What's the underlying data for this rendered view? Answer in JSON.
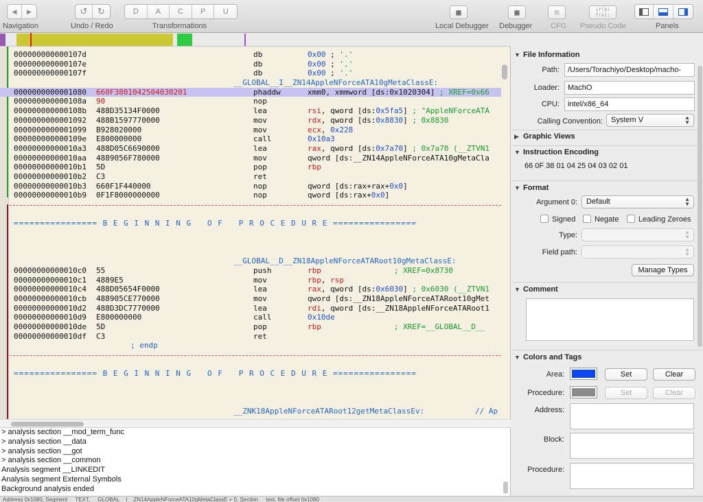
{
  "toolbar": {
    "navigation_label": "Navigation",
    "undo_redo_label": "Undo / Redo",
    "transformations_label": "Transformations",
    "transform_buttons": [
      "D",
      "A",
      "C",
      "P",
      "U"
    ],
    "nav_back": "◀",
    "nav_forward": "▶",
    "undo": "↺",
    "redo": "↻",
    "local_debugger_label": "Local Debugger",
    "debugger_label": "Debugger",
    "cfg_label": "CFG",
    "pseudo_code_label": "Pseudo Code",
    "pseudo_code_icon": "if(b)\nf(x);",
    "panels_label": "Panels"
  },
  "disasm": {
    "lines": [
      {
        "addr": "000000000000107d",
        "bytes": "",
        "mn": "db",
        "op_parts": [
          {
            "t": "0x00",
            "c": "blue"
          },
          {
            "t": " ; ",
            "c": ""
          },
          {
            "t": "'.'",
            "c": "green"
          }
        ]
      },
      {
        "addr": "000000000000107e",
        "bytes": "",
        "mn": "db",
        "op_parts": [
          {
            "t": "0x00",
            "c": "blue"
          },
          {
            "t": " ; ",
            "c": ""
          },
          {
            "t": "'.'",
            "c": "green"
          }
        ]
      },
      {
        "addr": "000000000000107f",
        "bytes": "",
        "mn": "db",
        "op_parts": [
          {
            "t": "0x00",
            "c": "blue"
          },
          {
            "t": " ; ",
            "c": ""
          },
          {
            "t": "'.'",
            "c": "green"
          }
        ]
      },
      {
        "label": "__GLOBAL__I__ZN14AppleNForceATA10gMetaClassE:"
      },
      {
        "addr": "0000000000001080",
        "bytes": "660F3801042504030201",
        "bytes_red": true,
        "mn": "phaddw",
        "hl": true,
        "op_parts": [
          {
            "t": "xmm0, xmmword [ds:0x1020304]",
            "c": ""
          },
          {
            "t": " ; XREF=0x66",
            "c": "green"
          }
        ]
      },
      {
        "addr": "000000000000108a",
        "bytes": "90",
        "bytes_red": true,
        "mn": "nop",
        "op_parts": []
      },
      {
        "addr": "000000000000108b",
        "bytes": "488D35134F0000",
        "mn": "lea",
        "op_parts": [
          {
            "t": "rsi",
            "c": "red"
          },
          {
            "t": ", qword [ds:",
            "c": ""
          },
          {
            "t": "0x5fa5",
            "c": "blue"
          },
          {
            "t": "]",
            "c": ""
          },
          {
            "t": " ; \"AppleNForceATA",
            "c": "green"
          }
        ]
      },
      {
        "addr": "0000000000001092",
        "bytes": "488B1597770000",
        "mn": "mov",
        "op_parts": [
          {
            "t": "rdx",
            "c": "red"
          },
          {
            "t": ", qword [ds:",
            "c": ""
          },
          {
            "t": "0x8830",
            "c": "blue"
          },
          {
            "t": "]",
            "c": ""
          },
          {
            "t": " ; 0x8830",
            "c": "green"
          }
        ]
      },
      {
        "addr": "0000000000001099",
        "bytes": "B928020000",
        "mn": "mov",
        "op_parts": [
          {
            "t": "ecx",
            "c": "red"
          },
          {
            "t": ", ",
            "c": ""
          },
          {
            "t": "0x228",
            "c": "blue"
          }
        ]
      },
      {
        "addr": "000000000000109e",
        "bytes": "E800000000",
        "mn": "call",
        "op_parts": [
          {
            "t": "0x10a3",
            "c": "blue"
          }
        ]
      },
      {
        "addr": "00000000000010a3",
        "bytes": "488D05C6690000",
        "mn": "lea",
        "op_parts": [
          {
            "t": "rax",
            "c": "red"
          },
          {
            "t": ", qword [ds:",
            "c": ""
          },
          {
            "t": "0x7a70",
            "c": "blue"
          },
          {
            "t": "]",
            "c": ""
          },
          {
            "t": " ; 0x7a70 (__ZTVN1",
            "c": "green"
          }
        ]
      },
      {
        "addr": "00000000000010aa",
        "bytes": "4889056F780000",
        "mn": "mov",
        "op_parts": [
          {
            "t": "qword [ds:__ZN14AppleNForceATA10gMetaCla",
            "c": ""
          }
        ]
      },
      {
        "addr": "00000000000010b1",
        "bytes": "5D",
        "mn": "pop",
        "op_parts": [
          {
            "t": "rbp",
            "c": "red"
          }
        ]
      },
      {
        "addr": "00000000000010b2",
        "bytes": "C3",
        "mn": "ret",
        "op_parts": []
      },
      {
        "addr": "00000000000010b3",
        "bytes": "660F1F440000",
        "mn": "nop",
        "op_parts": [
          {
            "t": "qword [ds:rax+rax+",
            "c": ""
          },
          {
            "t": "0x0",
            "c": "blue"
          },
          {
            "t": "]",
            "c": ""
          }
        ]
      },
      {
        "addr": "00000000000010b9",
        "bytes": "0F1F8000000000",
        "mn": "nop",
        "op_parts": [
          {
            "t": "qword [ds:rax+",
            "c": ""
          },
          {
            "t": "0x0",
            "c": "blue"
          },
          {
            "t": "]",
            "c": ""
          }
        ]
      },
      {
        "dash": true
      },
      {
        "blank": true
      },
      {
        "banner": "================ B E G I N N I N G   O F   P R O C E D U R E ================"
      },
      {
        "blank": true
      },
      {
        "blank": true
      },
      {
        "blank": true
      },
      {
        "label": "__GLOBAL__D__ZN18AppleNForceATARoot10gMetaClassE:"
      },
      {
        "addr": "00000000000010c0",
        "bytes": "55",
        "mn": "push",
        "op_parts": [
          {
            "t": "rbp",
            "c": "red"
          },
          {
            "t": "                ; XREF=0x8730",
            "c": "green"
          }
        ]
      },
      {
        "addr": "00000000000010c1",
        "bytes": "4889E5",
        "mn": "mov",
        "op_parts": [
          {
            "t": "rbp",
            "c": "red"
          },
          {
            "t": ", ",
            "c": ""
          },
          {
            "t": "rsp",
            "c": "red"
          }
        ]
      },
      {
        "addr": "00000000000010c4",
        "bytes": "488D05654F0000",
        "mn": "lea",
        "op_parts": [
          {
            "t": "rax",
            "c": "red"
          },
          {
            "t": ", qword [ds:",
            "c": ""
          },
          {
            "t": "0x6030",
            "c": "blue"
          },
          {
            "t": "]",
            "c": ""
          },
          {
            "t": " ; 0x6030 (__ZTVN1",
            "c": "green"
          }
        ]
      },
      {
        "addr": "00000000000010cb",
        "bytes": "488905CE770000",
        "mn": "mov",
        "op_parts": [
          {
            "t": "qword [ds:__ZN18AppleNForceATARoot10gMet",
            "c": ""
          }
        ]
      },
      {
        "addr": "00000000000010d2",
        "bytes": "488D3DC7770000",
        "mn": "lea",
        "op_parts": [
          {
            "t": "rdi",
            "c": "red"
          },
          {
            "t": ", qword [ds:__ZN18AppleNForceATARoot1",
            "c": ""
          }
        ]
      },
      {
        "addr": "00000000000010d9",
        "bytes": "E800000000",
        "mn": "call",
        "op_parts": [
          {
            "t": "0x10de",
            "c": "blue"
          }
        ]
      },
      {
        "addr": "00000000000010de",
        "bytes": "5D",
        "mn": "pop",
        "op_parts": [
          {
            "t": "rbp",
            "c": "red"
          },
          {
            "t": "                ; XREF=__GLOBAL__D__",
            "c": "green"
          }
        ]
      },
      {
        "addr": "00000000000010df",
        "bytes": "C3",
        "mn": "ret",
        "op_parts": []
      },
      {
        "endp": "; endp"
      },
      {
        "dash": true
      },
      {
        "blank": true
      },
      {
        "banner": "================ B E G I N N I N G   O F   P R O C E D U R E ================"
      },
      {
        "blank": true
      },
      {
        "blank": true
      },
      {
        "blank": true
      },
      {
        "label": "__ZNK18AppleNForceATARoot12getMetaClassEv:",
        "trail": "        // Ap"
      }
    ]
  },
  "console": {
    "lines": [
      "> analysis section __mod_term_func",
      "> analysis section __data",
      "> analysis section __got",
      "> analysis section __common",
      "Analysis segment __LINKEDIT",
      "Analysis segment External Symbols",
      "Background analysis ended"
    ]
  },
  "statusbar": "Address 0x1080, Segment __TEXT, __GLOBAL__I__ZN14AppleNForceATA10gMetaClassE + 0, Section __text, file offset 0x1080",
  "inspector": {
    "file_info": {
      "title": "File Information",
      "path_label": "Path:",
      "path": "/Users/Torachiyo/Desktop/macho-",
      "loader_label": "Loader:",
      "loader": "MachO",
      "cpu_label": "CPU:",
      "cpu": "intel/x86_64",
      "calling_label": "Calling Convention:",
      "calling": "System V"
    },
    "graphic_views_title": "Graphic Views",
    "encoding": {
      "title": "Instruction Encoding",
      "value": "66 0F 38 01 04 25 04 03 02 01"
    },
    "format": {
      "title": "Format",
      "argument_label": "Argument 0:",
      "argument": "Default",
      "signed": "Signed",
      "negate": "Negate",
      "leading_zeroes": "Leading Zeroes",
      "type_label": "Type:",
      "field_path_label": "Field path:",
      "manage_types": "Manage Types"
    },
    "comment_title": "Comment",
    "colors": {
      "title": "Colors and Tags",
      "area_label": "Area:",
      "area_color": "#0a46f2",
      "procedure_label": "Procedure:",
      "procedure_color": "#8c8c8c",
      "set": "Set",
      "clear": "Clear",
      "address_label": "Address:",
      "block_label": "Block:",
      "procedure_tag_label": "Procedure:"
    }
  }
}
